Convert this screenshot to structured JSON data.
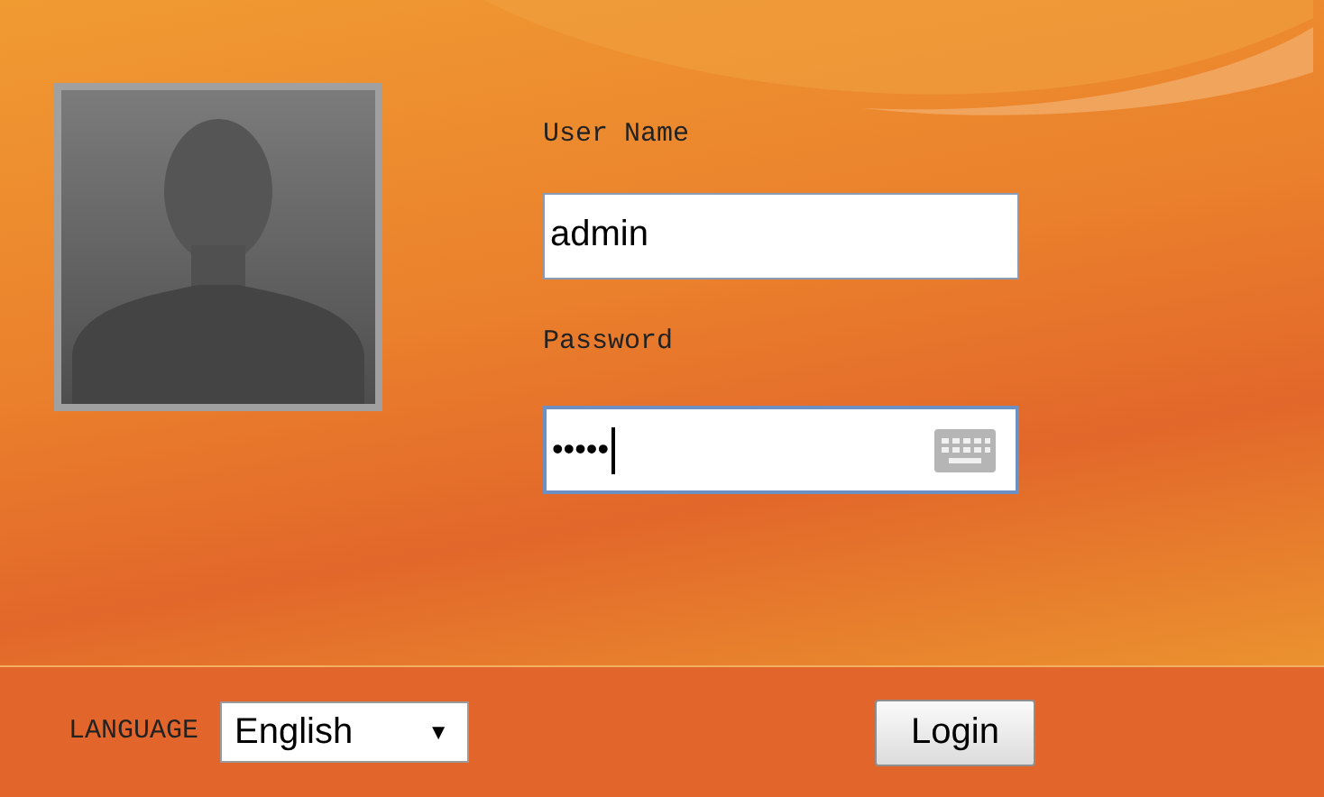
{
  "login_form": {
    "user_name": {
      "label": "User Name",
      "value": "admin"
    },
    "password": {
      "label": "Password",
      "value": "•••••",
      "focused": true
    }
  },
  "footer": {
    "language": {
      "label": "LANGUAGE",
      "value": "English",
      "arrow": "▼"
    },
    "login_button": "Login"
  }
}
